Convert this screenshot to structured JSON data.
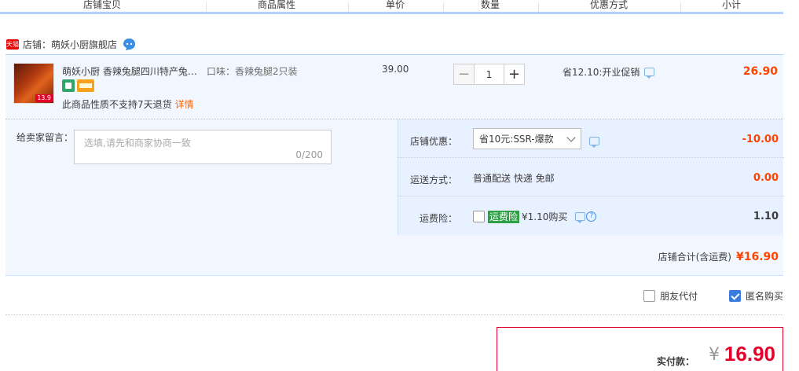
{
  "header": {
    "columns": [
      "店铺宝贝",
      "商品属性",
      "单价",
      "数量",
      "优惠方式",
      "小计"
    ]
  },
  "shop": {
    "badge": "天猫",
    "label": "店铺：萌妖小厨旗舰店"
  },
  "item": {
    "thumb_badge": "13.9",
    "title": "萌妖小厨 香辣兔腿四川特产兔…",
    "sku": "口味：香辣兔腿2只装",
    "price": "39.00",
    "quantity": "1",
    "promo": "省12.10:开业促销",
    "subtotal": "26.90",
    "return_note": "此商品性质不支持7天退货",
    "return_link": "详情",
    "qty_minus": "−",
    "qty_plus": "+"
  },
  "message": {
    "label": "给卖家留言：",
    "placeholder": "选填,请先和商家协商一致",
    "count": "0/200"
  },
  "discount": {
    "label": "店铺优惠：",
    "selected": "省10元:SSR-爆款",
    "amount": "-10.00"
  },
  "shipping": {
    "label": "运送方式：",
    "value": "普通配送 快递 免邮",
    "amount": "0.00"
  },
  "insurance": {
    "label": "运费险：",
    "tag": "运费险",
    "price": "¥1.10购买",
    "help": "?",
    "amount": "1.10"
  },
  "shop_total": {
    "label": "店铺合计(含运费)",
    "amount": "¥16.90"
  },
  "options": {
    "friend_pay": "朋友代付",
    "anonymous": "匿名购买"
  },
  "payment": {
    "label": "实付款：",
    "currency": "¥",
    "amount": "16.90"
  },
  "colors": {
    "accent_red": "#e4002b",
    "price_orange": "#ff4400",
    "header_border": "#b2d1ff",
    "row_bg": "#f2f7ff"
  }
}
